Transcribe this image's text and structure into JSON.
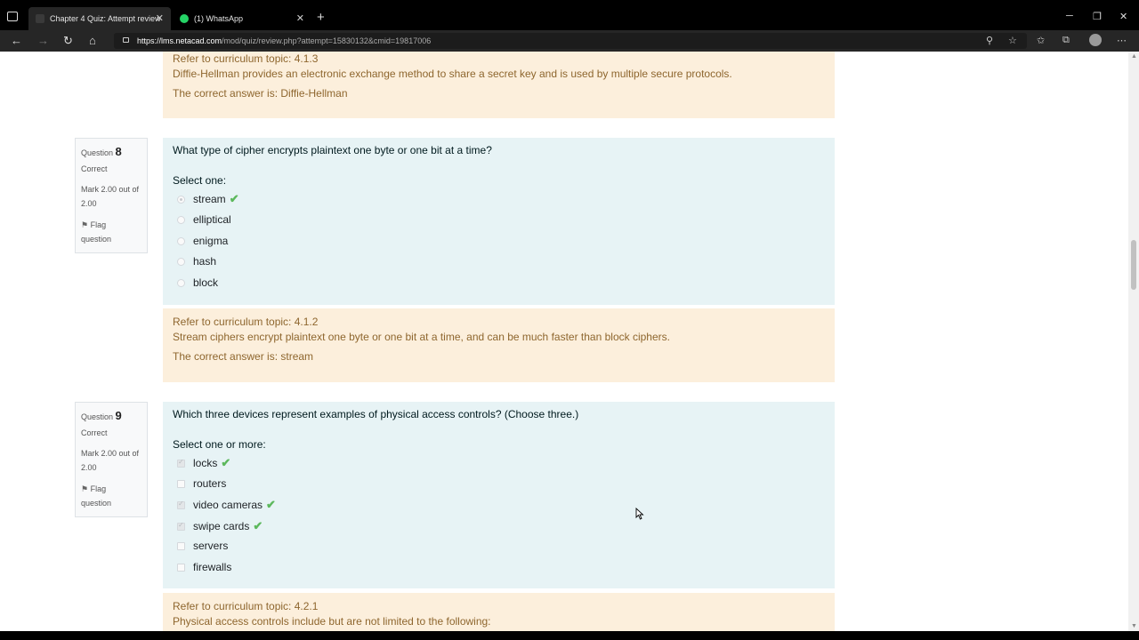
{
  "browser": {
    "tabs": [
      {
        "title": "Chapter 4 Quiz: Attempt review",
        "active": true
      },
      {
        "title": "(1) WhatsApp",
        "active": false
      }
    ],
    "url_host": "https://lms.netacad.com",
    "url_path": "/mod/quiz/review.php?attempt=15830132&cmid=19817006"
  },
  "feedback_top": {
    "topic": "Refer to curriculum topic: 4.1.3",
    "explanation": "Diffie-Hellman provides an electronic exchange method to share a secret key and is used by multiple secure protocols.",
    "answer": "The correct answer is: Diffie-Hellman"
  },
  "q8": {
    "label": "Question",
    "number": "8",
    "state": "Correct",
    "mark_1": "Mark 2.00 out of",
    "mark_2": "2.00",
    "flag_1": "Flag",
    "flag_2": "question",
    "text": "What type of cipher encrypts plaintext one byte or one bit at a time?",
    "prompt": "Select one:",
    "options": [
      {
        "label": "stream",
        "selected": true,
        "correct": true
      },
      {
        "label": "elliptical",
        "selected": false,
        "correct": false
      },
      {
        "label": "enigma",
        "selected": false,
        "correct": false
      },
      {
        "label": "hash",
        "selected": false,
        "correct": false
      },
      {
        "label": "block",
        "selected": false,
        "correct": false
      }
    ],
    "feedback": {
      "topic": "Refer to curriculum topic: 4.1.2",
      "explanation": "Stream ciphers encrypt plaintext one byte or one bit at a time, and can be much faster than block ciphers.",
      "answer": "The correct answer is: stream"
    }
  },
  "q9": {
    "label": "Question",
    "number": "9",
    "state": "Correct",
    "mark_1": "Mark 2.00 out of",
    "mark_2": "2.00",
    "flag_1": "Flag",
    "flag_2": "question",
    "text": "Which three devices represent examples of physical access controls? (Choose three.)",
    "prompt": "Select one or more:",
    "options": [
      {
        "label": "locks",
        "selected": true,
        "correct": true
      },
      {
        "label": "routers",
        "selected": false,
        "correct": false
      },
      {
        "label": "video cameras",
        "selected": true,
        "correct": true
      },
      {
        "label": "swipe cards",
        "selected": true,
        "correct": true
      },
      {
        "label": "servers",
        "selected": false,
        "correct": false
      },
      {
        "label": "firewalls",
        "selected": false,
        "correct": false
      }
    ],
    "feedback": {
      "topic": "Refer to curriculum topic: 4.2.1",
      "explanation": "Physical access controls include but are not limited to the following:"
    }
  },
  "colors": {
    "feedback_bg": "#fcefdc",
    "feedback_text": "#8e662e",
    "formulation_bg": "#e7f3f5",
    "correct_check": "#5cb85c"
  }
}
